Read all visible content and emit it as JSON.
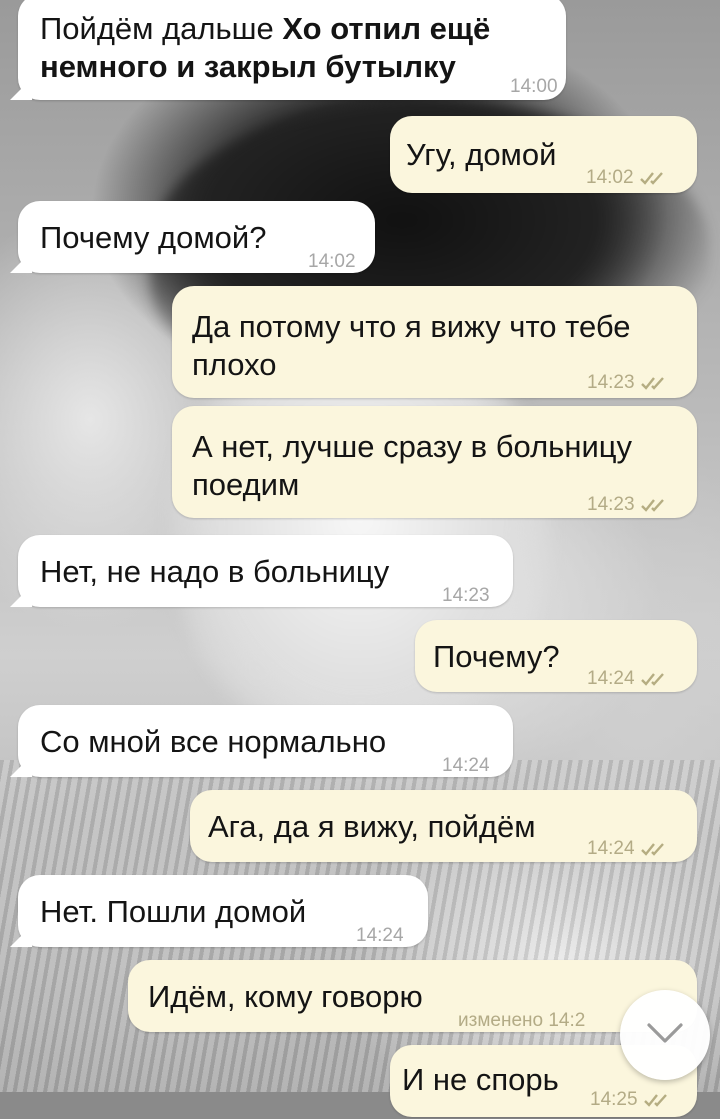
{
  "messages": [
    {
      "side": "in",
      "text_plain": "Пойдём дальше ",
      "text_bold": "Хо отпил ещё немного и закрыл бутылку",
      "time": "14:00"
    },
    {
      "side": "out",
      "text": "Угу, домой",
      "time": "14:02"
    },
    {
      "side": "in",
      "text": "Почему домой?",
      "time": "14:02"
    },
    {
      "side": "out",
      "text": "Да потому что я вижу что тебе плохо",
      "time": "14:23"
    },
    {
      "side": "out",
      "text": "А нет, лучше сразу в больницу поедим",
      "time": "14:23"
    },
    {
      "side": "in",
      "text": "Нет, не надо в больницу",
      "time": "14:23"
    },
    {
      "side": "out",
      "text": "Почему?",
      "time": "14:24"
    },
    {
      "side": "in",
      "text": "Со мной все нормально",
      "time": "14:24"
    },
    {
      "side": "out",
      "text": "Ага, да я вижу, пойдём",
      "time": "14:24"
    },
    {
      "side": "in",
      "text": "Нет. Пошли домой",
      "time": "14:24"
    },
    {
      "side": "out",
      "text": "Идём, кому говорю",
      "time": "изменено 14:2"
    },
    {
      "side": "out",
      "text": "И не спорь",
      "time": "14:25"
    }
  ],
  "icons": {
    "read_receipt": "double-check-icon",
    "scroll_down": "chevron-down-icon"
  },
  "colors": {
    "incoming_bubble": "#ffffff",
    "outgoing_bubble": "#fbf6dd",
    "tick": "#b5ad82"
  }
}
